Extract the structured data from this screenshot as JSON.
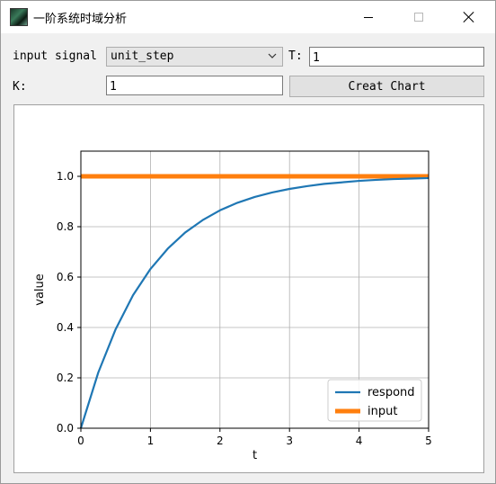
{
  "window": {
    "title": "一阶系统时域分析"
  },
  "controls": {
    "input_signal_label": "input signal",
    "input_signal_value": "unit_step",
    "t_label": "T:",
    "t_value": "1",
    "k_label": "K:",
    "k_value": "1",
    "create_button": "Creat Chart"
  },
  "colors": {
    "respond": "#1f77b4",
    "input": "#ff7f0e"
  },
  "chart_data": {
    "type": "line",
    "title": "",
    "xlabel": "t",
    "ylabel": "value",
    "xlim": [
      0,
      5
    ],
    "ylim": [
      0,
      1.1
    ],
    "xticks": [
      0,
      1,
      2,
      3,
      4,
      5
    ],
    "yticks": [
      0.0,
      0.2,
      0.4,
      0.6,
      0.8,
      1.0
    ],
    "ytick_labels": [
      "0.0",
      "0.2",
      "0.4",
      "0.6",
      "0.8",
      "1.0"
    ],
    "grid": true,
    "legend_position": "lower-right",
    "series": [
      {
        "name": "respond",
        "x": [
          0,
          0.25,
          0.5,
          0.75,
          1,
          1.25,
          1.5,
          1.75,
          2,
          2.25,
          2.5,
          2.75,
          3,
          3.25,
          3.5,
          3.75,
          4,
          4.25,
          4.5,
          4.75,
          5
        ],
        "y": [
          0,
          0.221,
          0.393,
          0.528,
          0.632,
          0.713,
          0.777,
          0.826,
          0.865,
          0.895,
          0.918,
          0.936,
          0.95,
          0.961,
          0.97,
          0.976,
          0.982,
          0.986,
          0.989,
          0.991,
          0.993
        ]
      },
      {
        "name": "input",
        "x": [
          0,
          5
        ],
        "y": [
          1,
          1
        ]
      }
    ]
  }
}
